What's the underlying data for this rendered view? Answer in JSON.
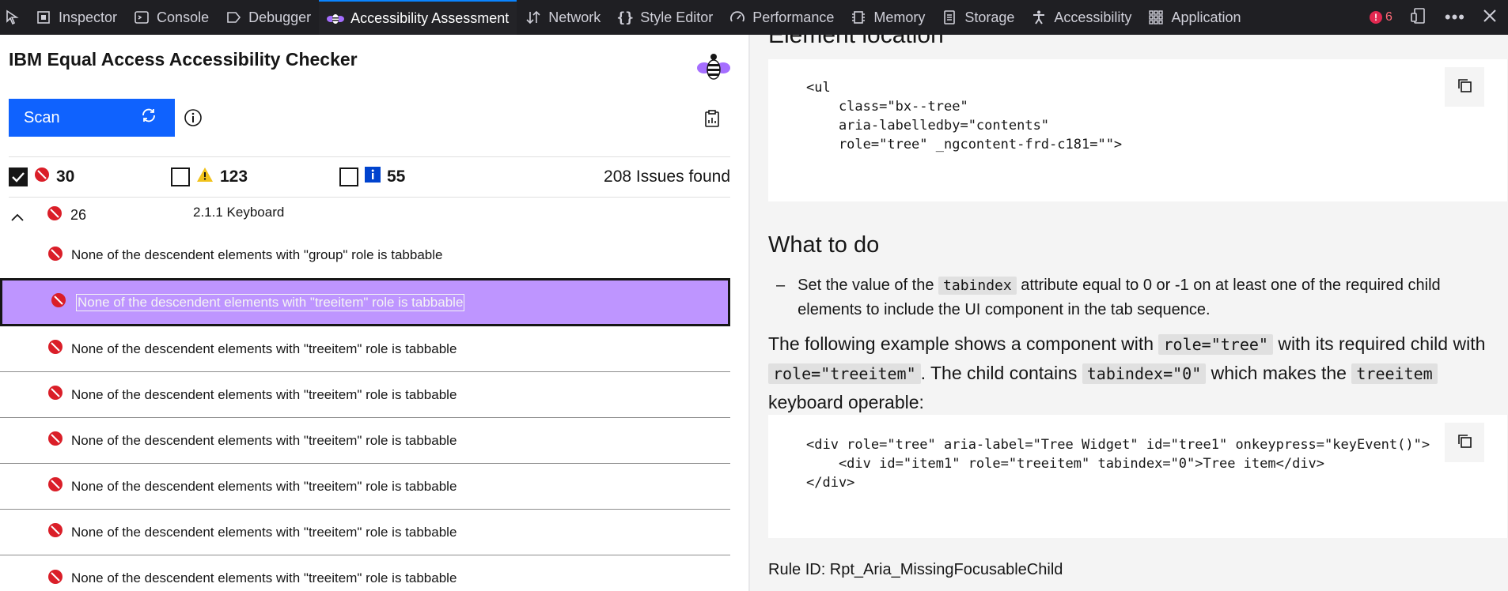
{
  "toolbar": {
    "tabs": [
      {
        "label": "Inspector",
        "icon": "inspector-icon"
      },
      {
        "label": "Console",
        "icon": "console-icon"
      },
      {
        "label": "Debugger",
        "icon": "debugger-icon"
      },
      {
        "label": "Accessibility Assessment",
        "icon": "bee-icon",
        "active": true
      },
      {
        "label": "Network",
        "icon": "network-icon"
      },
      {
        "label": "Style Editor",
        "icon": "style-editor-icon"
      },
      {
        "label": "Performance",
        "icon": "performance-icon"
      },
      {
        "label": "Memory",
        "icon": "memory-icon"
      },
      {
        "label": "Storage",
        "icon": "storage-icon"
      },
      {
        "label": "Accessibility",
        "icon": "accessibility-icon"
      },
      {
        "label": "Application",
        "icon": "application-icon"
      }
    ],
    "error_count": "6"
  },
  "checker": {
    "title": "IBM Equal Access Accessibility Checker",
    "scan_label": "Scan",
    "filters": {
      "violations": "30",
      "needs_review": "123",
      "recommendations": "55",
      "issues_found": "208 Issues found"
    },
    "group": {
      "count": "26",
      "label": "2.1.1 Keyboard"
    },
    "issues": [
      "None of the descendent elements with \"group\" role is tabbable",
      "None of the descendent elements with \"treeitem\" role is tabbable",
      "None of the descendent elements with \"treeitem\" role is tabbable",
      "None of the descendent elements with \"treeitem\" role is tabbable",
      "None of the descendent elements with \"treeitem\" role is tabbable",
      "None of the descendent elements with \"treeitem\" role is tabbable",
      "None of the descendent elements with \"treeitem\" role is tabbable",
      "None of the descendent elements with \"treeitem\" role is tabbable"
    ]
  },
  "detail": {
    "element_location_heading": "Element location",
    "element_code": "<ul\n    class=\"bx--tree\"\n    aria-labelledby=\"contents\"\n    role=\"tree\" _ngcontent-frd-c181=\"\">",
    "what_to_do_heading": "What to do",
    "bullet": {
      "pre": "Set the value of the",
      "code": "tabindex",
      "post": "attribute equal to 0 or -1 on at least one of the required child elements to include the UI component in the tab sequence."
    },
    "example": {
      "t1": "The following example shows a component with",
      "c1": "role=\"tree\"",
      "t2": "with its required child with",
      "c2": "role=\"treeitem\"",
      "t3": ". The child contains",
      "c3": "tabindex=\"0\"",
      "t4": "which makes the",
      "c4": "treeitem",
      "t5": "keyboard operable:"
    },
    "example_code": "<div role=\"tree\" aria-label=\"Tree Widget\" id=\"tree1\" onkeypress=\"keyEvent()\">\n    <div id=\"item1\" role=\"treeitem\" tabindex=\"0\">Tree item</div>\n</div>",
    "rule_id": "Rule ID: Rpt_Aria_MissingFocusableChild"
  },
  "colors": {
    "toolbar_bg": "#1f1f23",
    "accent_blue": "#0f62fe",
    "selected_row": "#be95ff",
    "violation_red": "#da1e28",
    "warning_yellow": "#f1c21b",
    "info_blue": "#0043ce"
  }
}
